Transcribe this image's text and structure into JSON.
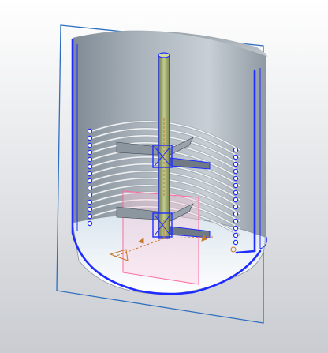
{
  "viewport": {
    "name": "3D CAD viewport",
    "background_top": "#ffffff",
    "background_bottom": "#c9ccd1"
  },
  "colors": {
    "vessel_fill_light": "#f4f6f8",
    "vessel_fill_dark": "#9aa3ab",
    "edge_blue": "#1f2cff",
    "datum_plane": "#2f6fbf",
    "coil": "#e8ecef",
    "coil_shadow": "#9ea6ad",
    "shaft": "#a8b37a",
    "shaft_dark": "#6e7a48",
    "blade": "#7d8791",
    "pink_plane": "#ff6aa0",
    "axis_orange": "#c57a2b"
  },
  "icons": {
    "csys": "coordinate-system-icon"
  }
}
